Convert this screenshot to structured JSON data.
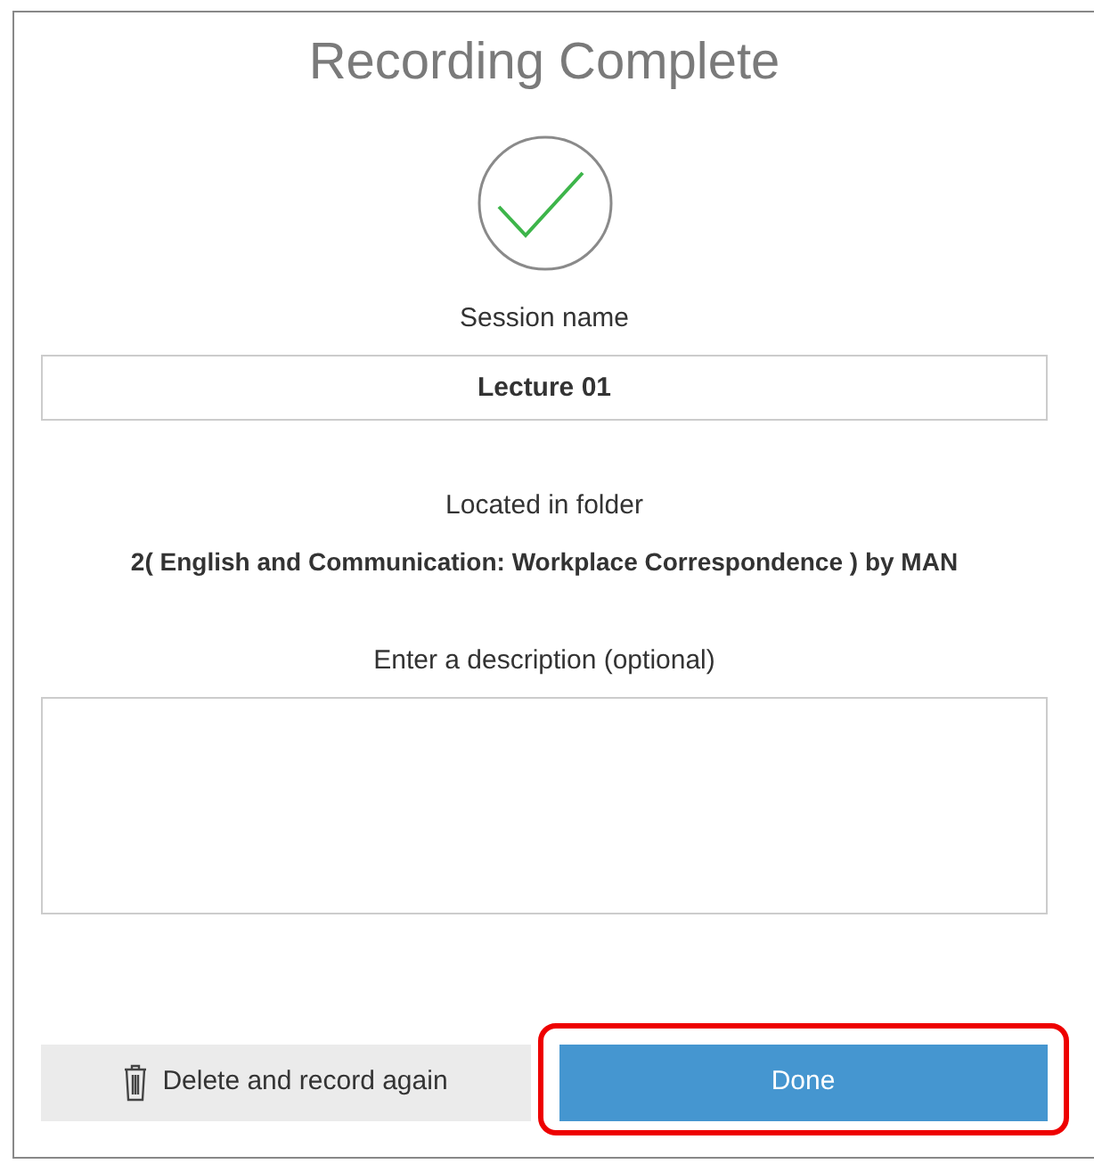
{
  "title": "Recording Complete",
  "session": {
    "label": "Session name",
    "value": "Lecture 01"
  },
  "folder": {
    "label": "Located in folder",
    "value": "2( English and Communication: Workplace Correspondence ) by MAN"
  },
  "description": {
    "label": "Enter a description (optional)"
  },
  "buttons": [
    {
      "kind": "secondary",
      "label": "Delete and record again",
      "highlighted": false
    },
    {
      "kind": "primary",
      "label": "Done",
      "highlighted": true
    }
  ]
}
